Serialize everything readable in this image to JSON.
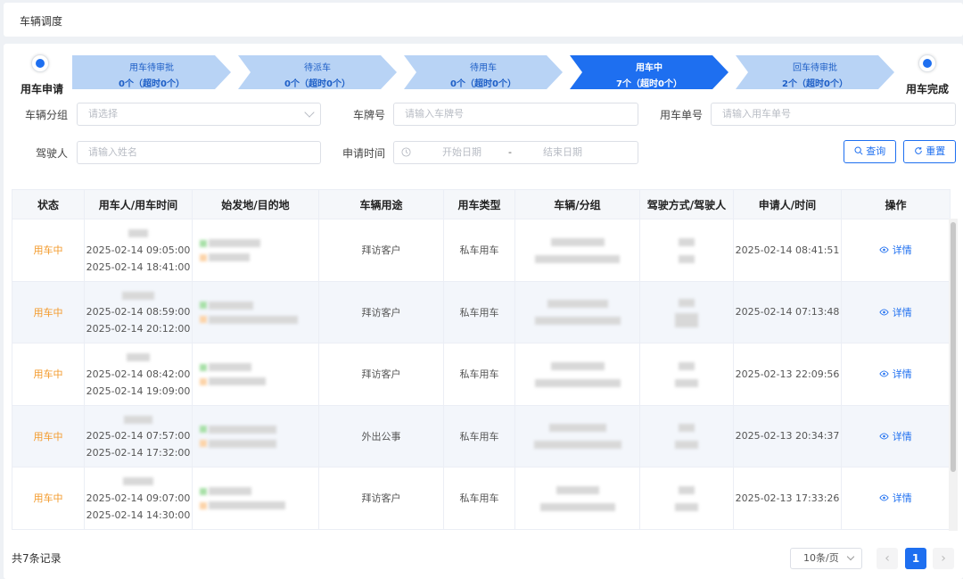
{
  "header": {
    "title": "车辆调度"
  },
  "steps": {
    "start_label": "用车申请",
    "end_label": "用车完成",
    "items": [
      {
        "name": "用车待审批",
        "count": "0个（超时0个）",
        "active": false
      },
      {
        "name": "待派车",
        "count": "0个（超时0个）",
        "active": false
      },
      {
        "name": "待用车",
        "count": "0个（超时0个）",
        "active": false
      },
      {
        "name": "用车中",
        "count": "7个（超时0个）",
        "active": true
      },
      {
        "name": "回车待审批",
        "count": "2个（超时0个）",
        "active": false
      }
    ]
  },
  "filters": {
    "group_label": "车辆分组",
    "group_placeholder": "请选择",
    "plate_label": "车牌号",
    "plate_placeholder": "请输入车牌号",
    "order_label": "用车单号",
    "order_placeholder": "请输入用车单号",
    "driver_label": "驾驶人",
    "driver_placeholder": "请输入姓名",
    "date_label": "申请时间",
    "start_placeholder": "开始日期",
    "date_sep": "-",
    "end_placeholder": "结束日期",
    "query_label": "查询",
    "reset_label": "重置"
  },
  "table": {
    "columns": [
      "状态",
      "用车人/用车时间",
      "始发地/目的地",
      "车辆用途",
      "用车类型",
      "车辆/分组",
      "驾驶方式/驾驶人",
      "申请人/时间",
      "操作"
    ],
    "rows": [
      {
        "status": "用车中",
        "start": "2025-02-14 09:05:00",
        "end": "2025-02-14 18:41:00",
        "purpose": "拜访客户",
        "type": "私车用车",
        "applied": "2025-02-14 08:41:51",
        "action": "详情"
      },
      {
        "status": "用车中",
        "start": "2025-02-14 08:59:00",
        "end": "2025-02-14 20:12:00",
        "purpose": "拜访客户",
        "type": "私车用车",
        "applied": "2025-02-14 07:13:48",
        "action": "详情"
      },
      {
        "status": "用车中",
        "start": "2025-02-14 08:42:00",
        "end": "2025-02-14 19:09:00",
        "purpose": "拜访客户",
        "type": "私车用车",
        "applied": "2025-02-13 22:09:56",
        "action": "详情"
      },
      {
        "status": "用车中",
        "start": "2025-02-14 07:57:00",
        "end": "2025-02-14 17:32:00",
        "purpose": "外出公事",
        "type": "私车用车",
        "applied": "2025-02-13 20:34:37",
        "action": "详情"
      },
      {
        "status": "用车中",
        "start": "2025-02-14 09:07:00",
        "end": "2025-02-14 14:30:00",
        "purpose": "拜访客户",
        "type": "私车用车",
        "applied": "2025-02-13 17:33:26",
        "action": "详情"
      }
    ]
  },
  "footer": {
    "total": "共7条记录",
    "page_size": "10条/页",
    "current_page": "1"
  },
  "icons": {
    "search": "search-icon",
    "reset": "refresh-icon",
    "calendar": "clock-icon",
    "view": "eye-icon"
  },
  "colors": {
    "accent": "#1e6ff0",
    "step_inactive": "#b8d3f5",
    "status": "#f39a2b"
  }
}
